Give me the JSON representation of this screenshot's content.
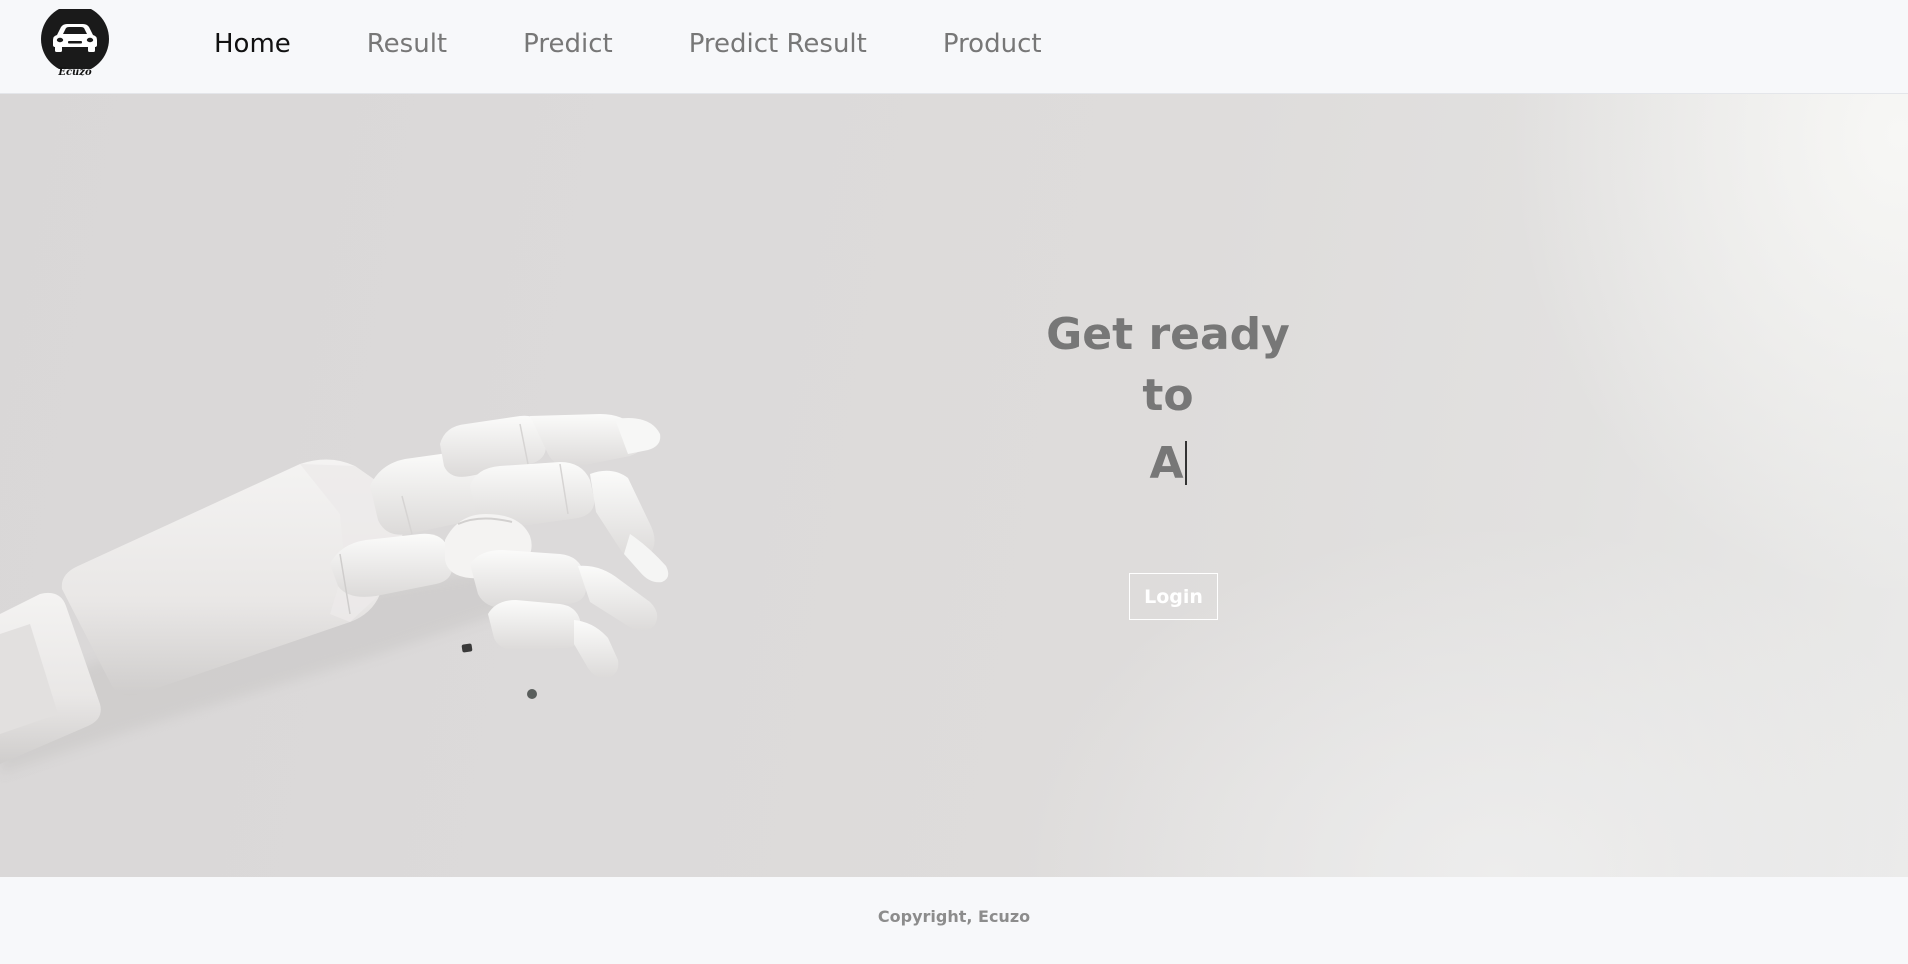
{
  "brand": {
    "name": "Ecuzo",
    "logo_icon": "car-icon"
  },
  "nav": {
    "items": [
      {
        "label": "Home",
        "active": true
      },
      {
        "label": "Result",
        "active": false
      },
      {
        "label": "Predict",
        "active": false
      },
      {
        "label": "Predict Result",
        "active": false
      },
      {
        "label": "Product",
        "active": false
      }
    ]
  },
  "hero": {
    "line1": "Get ready",
    "line2": "to",
    "typed_text": "A",
    "login_label": "Login",
    "image": "robot-hand"
  },
  "footer": {
    "copyright": "Copyright, Ecuzo"
  },
  "colors": {
    "nav_active": "#111111",
    "nav_inactive": "#777777",
    "hero_text": "#777777",
    "button_border": "#ffffff",
    "footer_text": "#8c8c8c"
  }
}
